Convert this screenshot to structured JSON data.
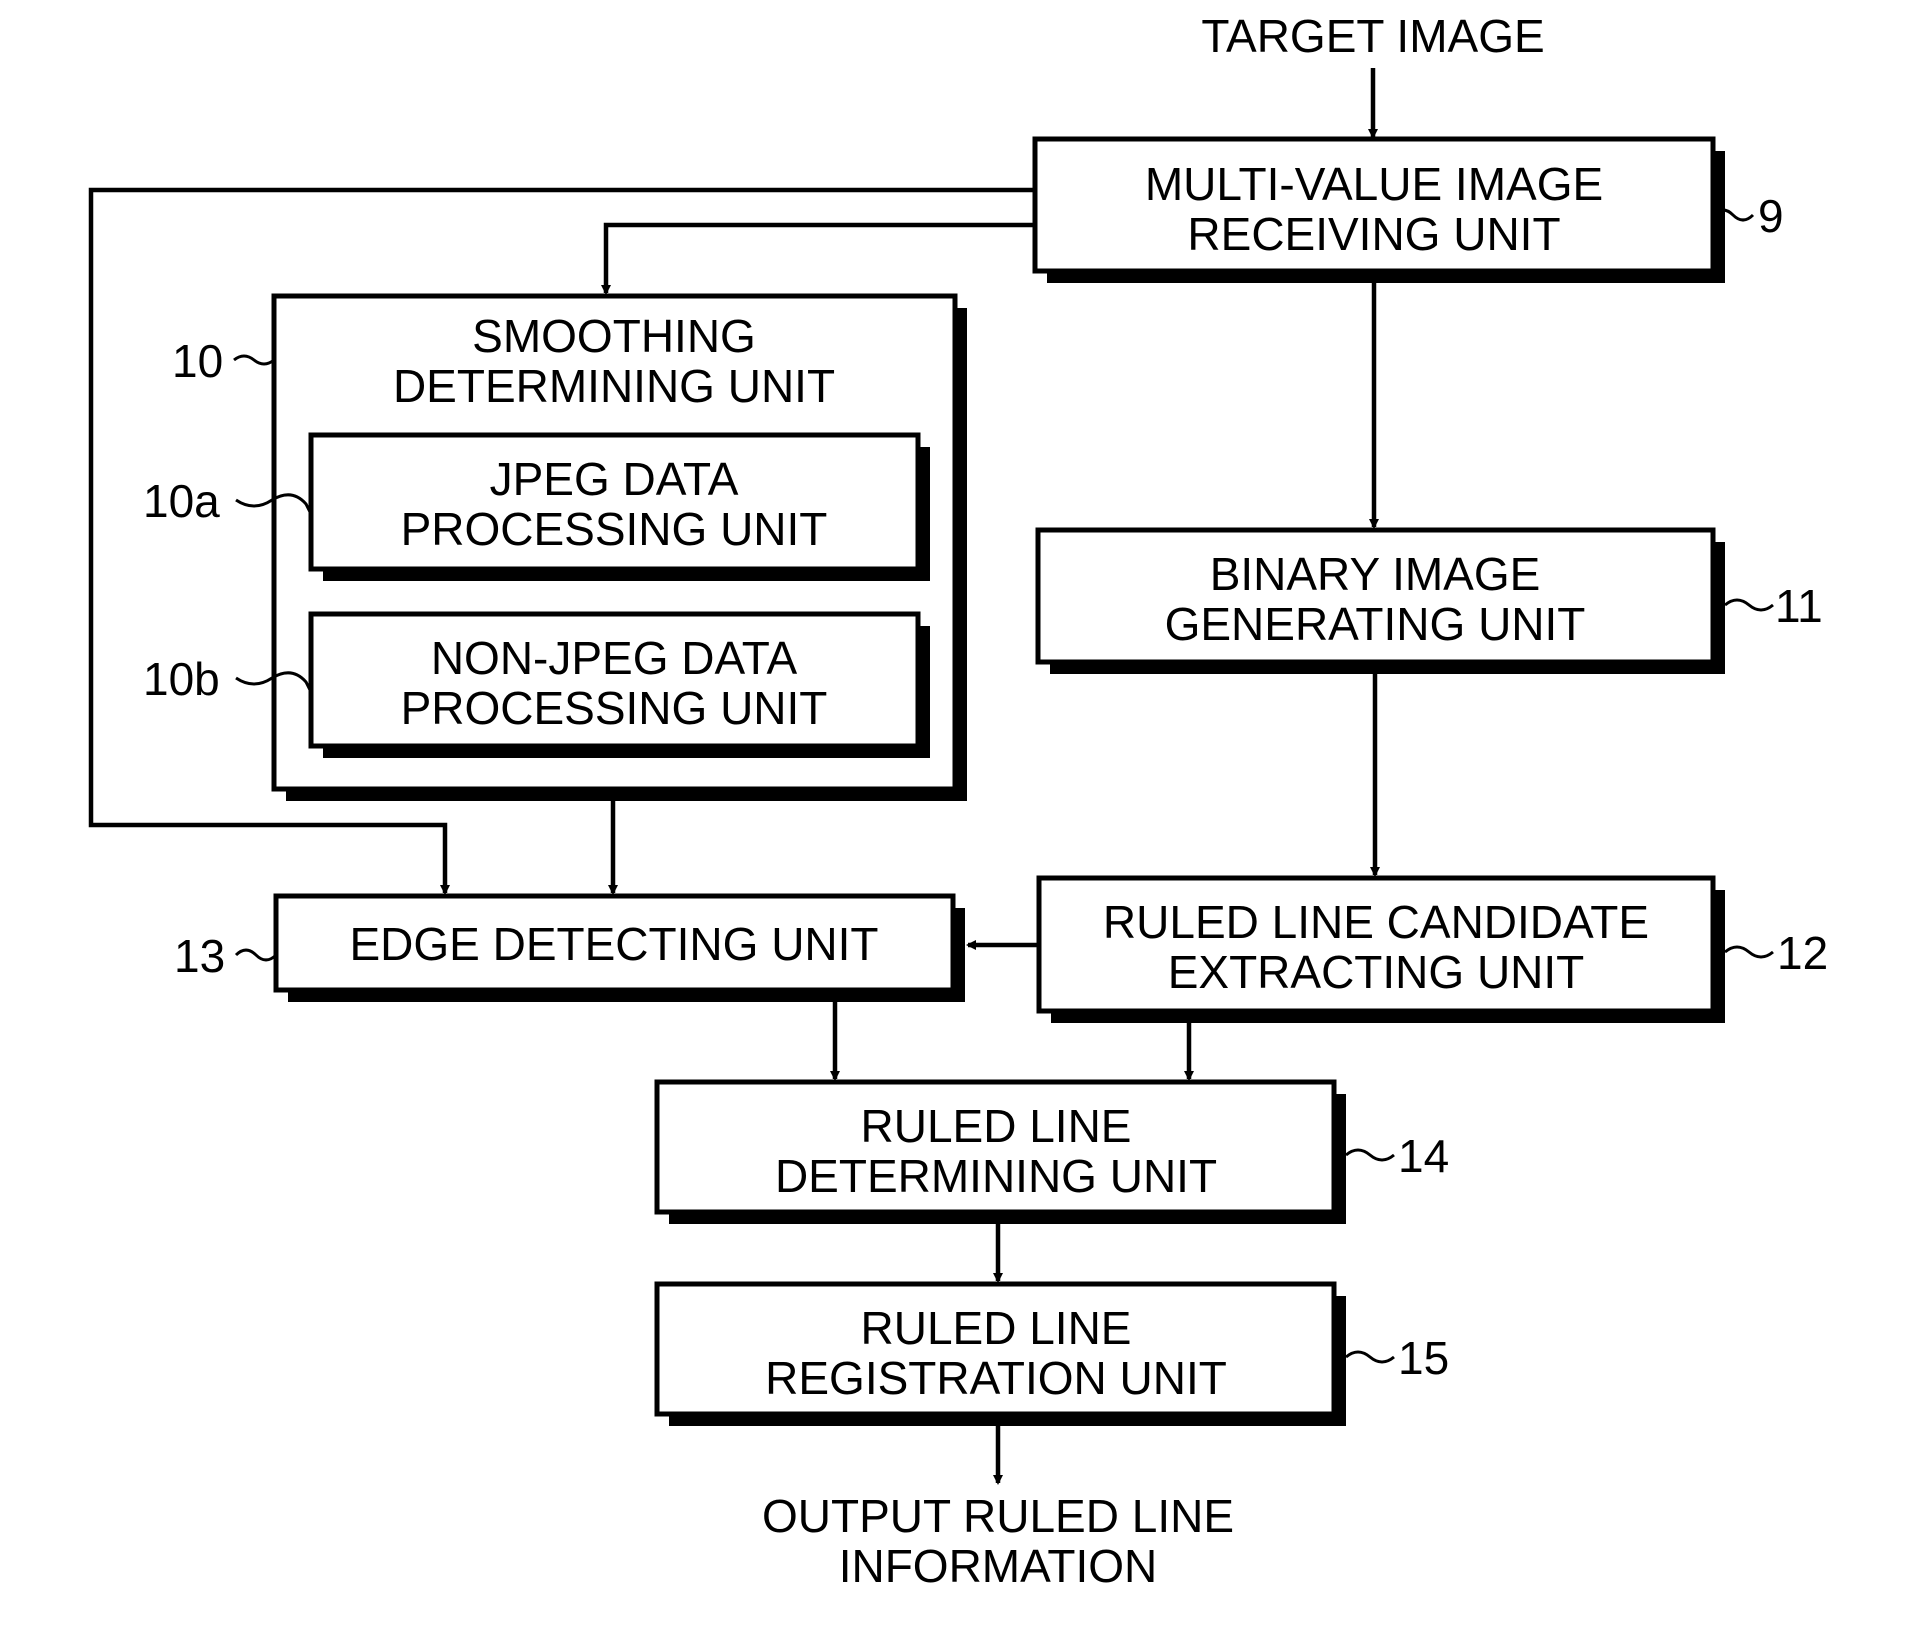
{
  "figure": {
    "input_label": "TARGET IMAGE",
    "output_label": [
      "OUTPUT RULED LINE",
      "INFORMATION"
    ],
    "units": {
      "multi_value": {
        "ref": "9",
        "lines": [
          "MULTI-VALUE IMAGE",
          "RECEIVING UNIT"
        ]
      },
      "smoothing": {
        "ref": "10",
        "lines": [
          "SMOOTHING",
          "DETERMINING UNIT"
        ]
      },
      "jpeg": {
        "ref": "10a",
        "lines": [
          "JPEG DATA",
          "PROCESSING UNIT"
        ]
      },
      "non_jpeg": {
        "ref": "10b",
        "lines": [
          "NON-JPEG DATA",
          "PROCESSING UNIT"
        ]
      },
      "binary": {
        "ref": "11",
        "lines": [
          "BINARY IMAGE",
          "GENERATING UNIT"
        ]
      },
      "candidate": {
        "ref": "12",
        "lines": [
          "RULED LINE CANDIDATE",
          "EXTRACTING UNIT"
        ]
      },
      "edge": {
        "ref": "13",
        "lines": [
          "EDGE DETECTING UNIT"
        ]
      },
      "determining": {
        "ref": "14",
        "lines": [
          "RULED LINE",
          "DETERMINING UNIT"
        ]
      },
      "registration": {
        "ref": "15",
        "lines": [
          "RULED LINE",
          "REGISTRATION UNIT"
        ]
      }
    }
  }
}
